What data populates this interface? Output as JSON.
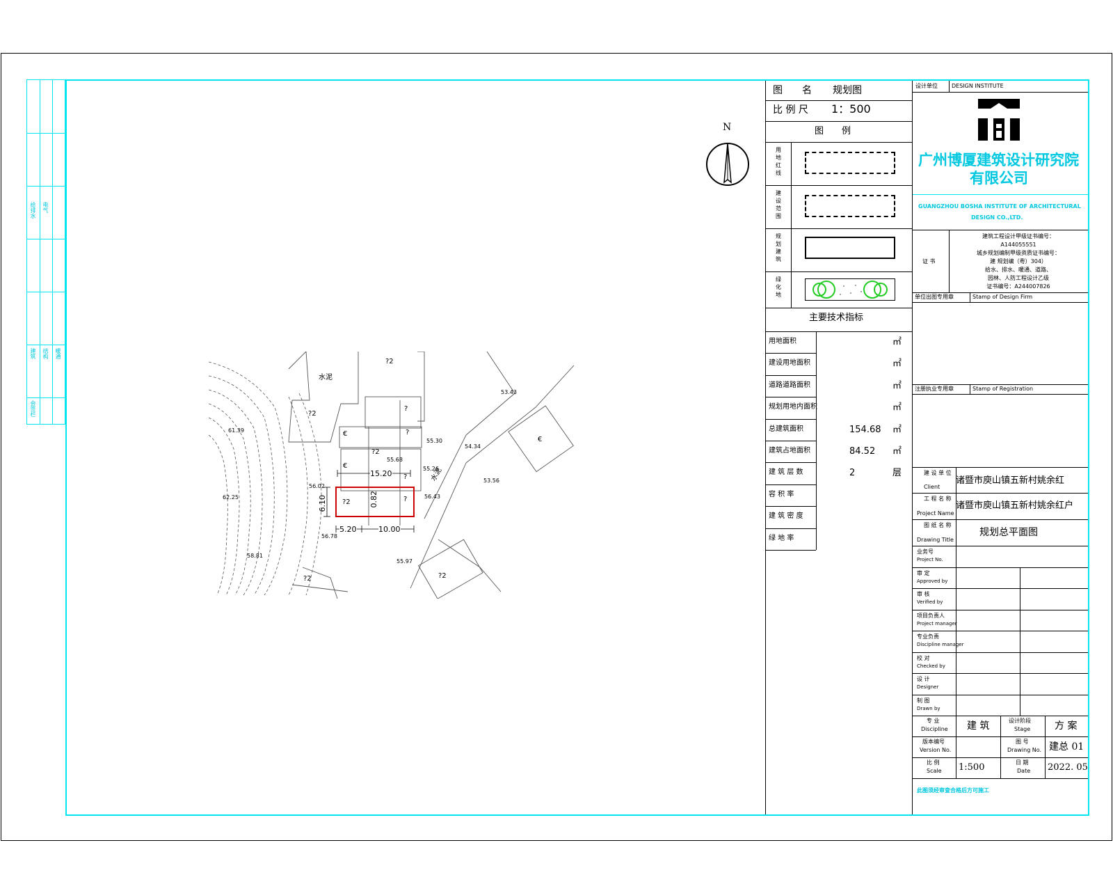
{
  "legend_panel": {
    "drawing_label": "图　　名",
    "drawing_name": "规划图",
    "scale_label": "比 例 尺",
    "scale_value": "1：500",
    "legend_title": "图　　例",
    "legend_items": [
      {
        "label": "用地红线",
        "style": "dash-dot"
      },
      {
        "label": "建设范围",
        "style": "dashed"
      },
      {
        "label": "规划建筑",
        "style": "solid"
      },
      {
        "label": "绿化地",
        "style": "trees"
      }
    ],
    "indicators_title": "主要技术指标",
    "indicators": [
      {
        "label": "用地面积",
        "value": "",
        "unit": "㎡"
      },
      {
        "label": "建设用地面积",
        "value": "",
        "unit": "㎡"
      },
      {
        "label": "道路道路面积",
        "value": "",
        "unit": "㎡"
      },
      {
        "label": "规划用地内面积",
        "value": "",
        "unit": "㎡"
      },
      {
        "label": "总建筑面积",
        "value": "154.68",
        "unit": "㎡"
      },
      {
        "label": "建筑占地面积",
        "value": "84.52",
        "unit": "㎡"
      },
      {
        "label": "建 筑 层 数",
        "value": "2",
        "unit": "层"
      },
      {
        "label": "容 积 率",
        "value": "",
        "unit": ""
      },
      {
        "label": "建 筑 密 度",
        "value": "",
        "unit": ""
      },
      {
        "label": "绿 地 率",
        "value": "",
        "unit": ""
      }
    ]
  },
  "title_block": {
    "design_unit_label": "设计单位",
    "design_unit_en": "DESIGN INSTITUTE",
    "company_cn_1": "广州博厦建筑设计研究院",
    "company_cn_2": "有限公司",
    "company_en_1": "GUANGZHOU BOSHA INSTITUTE OF ARCHITECTURAL",
    "company_en_2": "DESIGN CO.,LTD.",
    "cert_label": "证 书",
    "cert_lines": [
      "建筑工程设计甲级证书编号：",
      "A144055551",
      "城乡规划编制甲级资质证书编号：",
      "建 规划编（粤）304）",
      "给水、排水、暖通、道路、",
      "园林、人防工程设计乙级",
      "证书编号：A244007826"
    ],
    "stamp_label": "单位出图专用章",
    "stamp_en": "Stamp of Design Firm",
    "reg_label": "注册执业专用章",
    "reg_en": "Stamp of Registration",
    "client_label": "建 设 单 位",
    "client_en": "Client",
    "client_value": "诸暨市庾山镇五新村姚余红",
    "project_label": "工 程 名 称",
    "project_en": "Project Name",
    "project_value": "诸暨市庾山镇五新村姚余红户",
    "drawing_title_label": "图 纸 名 称",
    "drawing_title_en": "Drawing Title",
    "drawing_title_value": "规划总平面图",
    "rows": [
      {
        "cn": "业务号",
        "en": "Project No."
      },
      {
        "cn": "审 定",
        "en": "Approved by"
      },
      {
        "cn": "审 核",
        "en": "Verified by"
      },
      {
        "cn": "项目负责人",
        "en": "Project manager"
      },
      {
        "cn": "专业负责",
        "en": "Discipline manager"
      },
      {
        "cn": "校 对",
        "en": "Checked by"
      },
      {
        "cn": "设 计",
        "en": "Designer"
      },
      {
        "cn": "制 图",
        "en": "Drawn by"
      }
    ],
    "discipline_label": "专 业",
    "discipline_en": "Discipline",
    "discipline_value": "建 筑",
    "stage_label": "设计阶段",
    "stage_en": "Stage",
    "stage_value": "方 案",
    "version_label": "版本编号",
    "version_en": "Version No.",
    "drawing_no_label": "图 号",
    "drawing_no_en": "Drawing No.",
    "drawing_no_value": "建总 01",
    "scale_label": "比 例",
    "scale_en": "Scale",
    "scale_value": "1:500",
    "date_label": "日 期",
    "date_en": "Date",
    "date_value": "2022. 05",
    "footer_note": "此图须经审查合格后方可施工"
  },
  "binding_strip": {
    "labels": [
      "会签栏",
      "建筑",
      "结构",
      "给排水",
      "电气",
      "暖通"
    ]
  },
  "plan": {
    "north": "N",
    "dims": [
      "15.20",
      "6.10",
      "5.20",
      "10.00",
      "0.82"
    ],
    "elevations": [
      "61.39",
      "62.25",
      "58.81",
      "56.78",
      "55.30",
      "55.68",
      "55.26",
      "54.34",
      "53.43",
      "53.56",
      "56.43",
      "55.97",
      "56.02"
    ],
    "labels": [
      "水泥",
      "?2",
      "?2",
      "?2",
      "?2",
      "?2",
      "?2",
      "?",
      "?",
      "?",
      "?",
      "€",
      "€",
      "€",
      "水泥"
    ]
  },
  "colors": {
    "frame": "#00e5ee",
    "site": "#cc0000",
    "tree": "#22cc22",
    "company": "#00c8e0"
  }
}
